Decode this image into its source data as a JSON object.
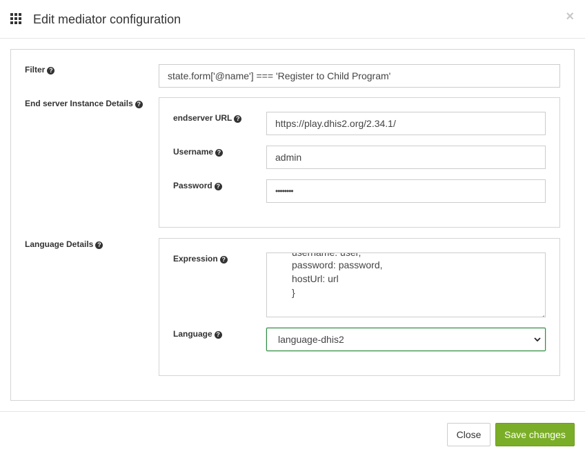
{
  "header": {
    "title": "Edit mediator configuration",
    "menu_icon": "grid-icon",
    "close_glyph": "×"
  },
  "form": {
    "filter": {
      "label": "Filter",
      "value": "state.form['@name'] === 'Register to Child Program'"
    },
    "endserver": {
      "label": "End server Instance Details",
      "url_label": "endserver URL",
      "url_value": "https://play.dhis2.org/2.34.1/",
      "username_label": "Username",
      "username_value": "admin",
      "password_label": "Password",
      "password_value": "••••••••"
    },
    "language_details": {
      "label": "Language Details",
      "expression_label": "Expression",
      "expression_lines": [
        "username: user,",
        "password: password,",
        "hostUrl: url",
        "}"
      ],
      "language_label": "Language",
      "language_value": "language-dhis2"
    }
  },
  "footer": {
    "close_label": "Close",
    "save_label": "Save changes"
  },
  "colors": {
    "save_button": "#7bae28",
    "select_focus_border": "#2e8b40"
  }
}
